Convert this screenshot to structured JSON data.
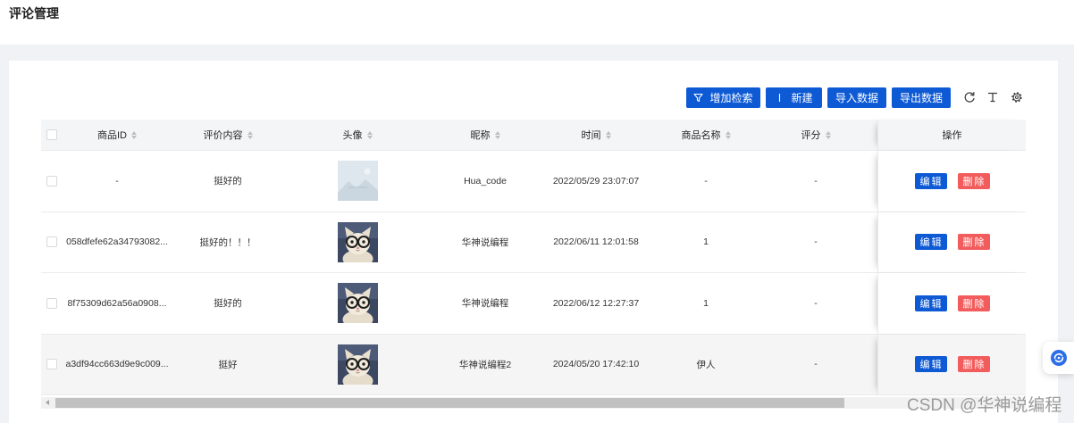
{
  "page": {
    "title": "评论管理"
  },
  "toolbar": {
    "search_label": "增加检索",
    "search_icon": "filter-icon",
    "new_label": "新建",
    "new_icon": "add-icon",
    "import_label": "导入数据",
    "export_label": "导出数据",
    "icons": [
      "reload-icon",
      "column-height-icon",
      "setting-icon"
    ]
  },
  "table": {
    "columns": {
      "id": "商品ID",
      "content": "评价内容",
      "avatar": "头像",
      "nickname": "昵称",
      "time": "时间",
      "product": "商品名称",
      "score": "评分",
      "action": "操作"
    },
    "rows": [
      {
        "id": "-",
        "content": "挺好的",
        "avatar_icon": "empty-image-icon",
        "nickname": "Hua_code",
        "time": "2022/05/29 23:07:07",
        "product": "-",
        "score": "-"
      },
      {
        "id": "058dfefe62a34793082...",
        "content": "挺好的！！！",
        "avatar_icon": "cat-avatar-icon",
        "nickname": "华神说编程",
        "time": "2022/06/11 12:01:58",
        "product": "1",
        "score": "-"
      },
      {
        "id": "8f75309d62a56a0908...",
        "content": "挺好的",
        "avatar_icon": "cat-avatar-icon",
        "nickname": "华神说编程",
        "time": "2022/06/12 12:27:37",
        "product": "1",
        "score": "-"
      },
      {
        "id": "a3df94cc663d9e9c009...",
        "content": "挺好",
        "avatar_icon": "cat-avatar-icon",
        "nickname": "华神说编程2",
        "time": "2024/05/20 17:42:10",
        "product": "伊人",
        "score": "-"
      }
    ],
    "actions": {
      "edit": "编辑",
      "delete": "删除"
    }
  },
  "watermark": "CSDN @华神说编程",
  "float_button_icon": "assistant-icon",
  "colors": {
    "primary": "#0e5ad5",
    "danger": "#f25c5c",
    "page_background": "#f0f2f5",
    "table_header_background": "#f4f5f7"
  }
}
